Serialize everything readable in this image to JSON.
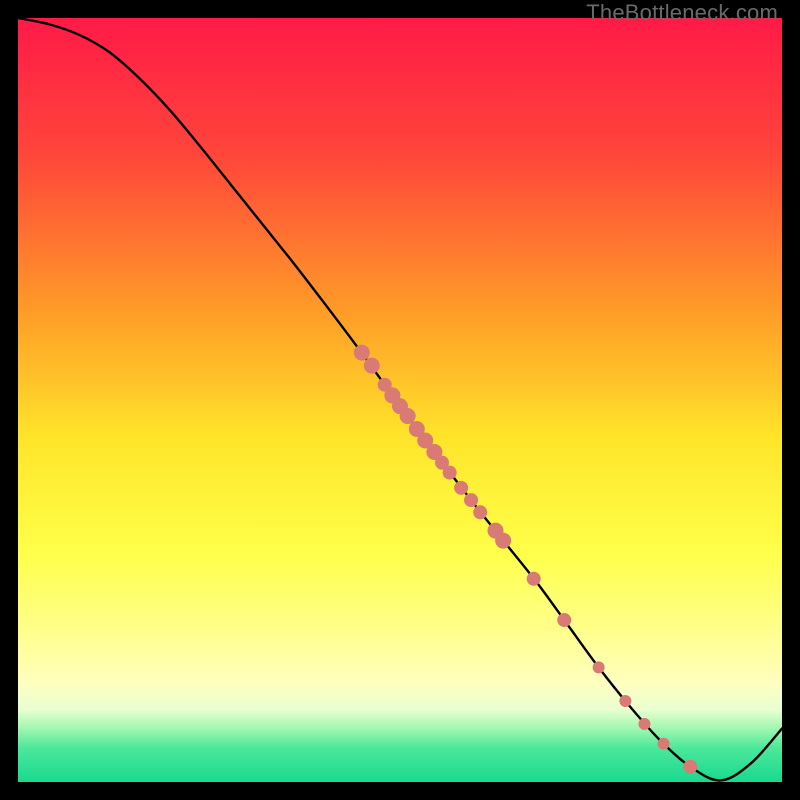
{
  "watermark": "TheBottleneck.com",
  "chart_data": {
    "type": "line",
    "title": "",
    "xlabel": "",
    "ylabel": "",
    "xlim": [
      0,
      100
    ],
    "ylim": [
      0,
      100
    ],
    "gradient_stops": [
      {
        "offset": 0.0,
        "color": "#ff1a47"
      },
      {
        "offset": 0.18,
        "color": "#ff463a"
      },
      {
        "offset": 0.38,
        "color": "#ff9a28"
      },
      {
        "offset": 0.55,
        "color": "#ffe52a"
      },
      {
        "offset": 0.7,
        "color": "#ffff4a"
      },
      {
        "offset": 0.8,
        "color": "#ffff8a"
      },
      {
        "offset": 0.87,
        "color": "#ffffc0"
      },
      {
        "offset": 0.905,
        "color": "#e9ffd0"
      },
      {
        "offset": 0.93,
        "color": "#a1f7b0"
      },
      {
        "offset": 0.955,
        "color": "#4de89a"
      },
      {
        "offset": 1.0,
        "color": "#17d98f"
      }
    ],
    "series": [
      {
        "name": "curve",
        "x": [
          0,
          4,
          8,
          12,
          16,
          20,
          24,
          28,
          32,
          36,
          40,
          44,
          48,
          52,
          56,
          60,
          64,
          68,
          72,
          76,
          80,
          84,
          88,
          92,
          96,
          100
        ],
        "y": [
          100,
          99.2,
          97.8,
          95.5,
          92.0,
          87.8,
          83.0,
          78.0,
          73.0,
          68.0,
          62.8,
          57.5,
          52.0,
          46.5,
          41.2,
          36.0,
          31.0,
          26.0,
          20.5,
          15.0,
          10.0,
          5.5,
          2.0,
          0.2,
          2.5,
          7.0
        ]
      }
    ],
    "markers": {
      "color": "#d97a74",
      "radius_default": 6,
      "points": [
        {
          "x": 45.0,
          "y": 56.2,
          "r": 8
        },
        {
          "x": 46.3,
          "y": 54.5,
          "r": 8
        },
        {
          "x": 48.0,
          "y": 52.0,
          "r": 7
        },
        {
          "x": 49.0,
          "y": 50.6,
          "r": 8
        },
        {
          "x": 50.0,
          "y": 49.2,
          "r": 8
        },
        {
          "x": 51.0,
          "y": 47.9,
          "r": 8
        },
        {
          "x": 52.2,
          "y": 46.2,
          "r": 8
        },
        {
          "x": 53.3,
          "y": 44.7,
          "r": 8
        },
        {
          "x": 54.5,
          "y": 43.2,
          "r": 8
        },
        {
          "x": 55.5,
          "y": 41.8,
          "r": 7
        },
        {
          "x": 56.5,
          "y": 40.5,
          "r": 7
        },
        {
          "x": 58.0,
          "y": 38.5,
          "r": 7
        },
        {
          "x": 59.3,
          "y": 36.9,
          "r": 7
        },
        {
          "x": 60.5,
          "y": 35.3,
          "r": 7
        },
        {
          "x": 62.5,
          "y": 32.9,
          "r": 8
        },
        {
          "x": 63.5,
          "y": 31.6,
          "r": 8
        },
        {
          "x": 67.5,
          "y": 26.6,
          "r": 7
        },
        {
          "x": 71.5,
          "y": 21.2,
          "r": 7
        },
        {
          "x": 76.0,
          "y": 15.0,
          "r": 6
        },
        {
          "x": 79.5,
          "y": 10.6,
          "r": 6
        },
        {
          "x": 82.0,
          "y": 7.6,
          "r": 6
        },
        {
          "x": 84.5,
          "y": 5.0,
          "r": 6
        },
        {
          "x": 88.0,
          "y": 2.0,
          "r": 7
        }
      ]
    }
  }
}
